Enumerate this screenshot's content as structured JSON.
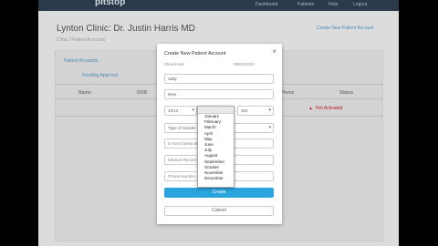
{
  "app": {
    "logo": "pitstop",
    "nav": [
      "Dashboard",
      "Patients",
      "Help",
      "Logout"
    ],
    "page_title": "Lynton Clinic: Dr. Justin Harris MD",
    "breadcrumb": "Clinic  /  Patient Accounts",
    "right_link": "Create New Patient Account",
    "panel_items": [
      "Patient Accounts",
      "Pending Approval"
    ],
    "table_headers": [
      "Name",
      "DOB",
      "Phone",
      "Status"
    ],
    "status_text": "Not Activated"
  },
  "modal": {
    "title": "Create New Patient Account",
    "clinic_label": "Clinic/Host",
    "clinic_code": "000101010",
    "first_name_value": "Sally",
    "last_name_value": "New",
    "dob_day": "20/13",
    "dob_year": "300",
    "gender_placeholder": "Type of Gender",
    "email_placeholder": "E-mail (Optional)",
    "medical_placeholder": "Medical Record #",
    "phone_placeholder": "Phone Number (Optional)",
    "create_label": "Create",
    "cancel_label": "Cancel",
    "close_glyph": "×"
  },
  "dropdown": {
    "months": [
      "January",
      "February",
      "March",
      "April",
      "May",
      "June",
      "July",
      "August",
      "September",
      "October",
      "November",
      "December"
    ]
  }
}
